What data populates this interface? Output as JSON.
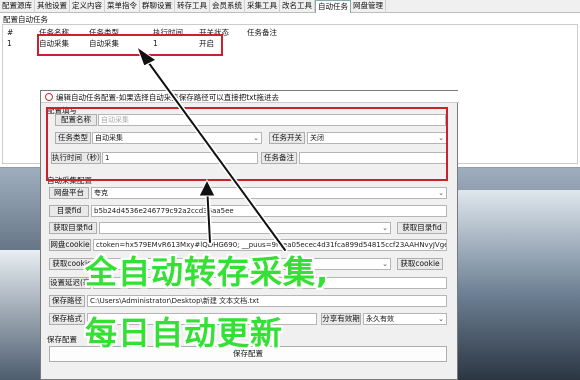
{
  "tabs": [
    "配置源库",
    "其他设置",
    "定义内容",
    "菜单指令",
    "群聊设置",
    "转存工具",
    "会员系统",
    "采集工具",
    "改名工具",
    "自动任务",
    "网盘管理"
  ],
  "active_tab_index": 9,
  "section_label": "配置自动任务",
  "grid": {
    "headers": [
      "#",
      "任务名称",
      "任务类型",
      "执行时间",
      "开关状态",
      "任务备注"
    ],
    "rows": [
      [
        "1",
        "自动采集",
        "自动采集",
        "1",
        "开启",
        ""
      ]
    ]
  },
  "dialog": {
    "title": "编辑自动任务配置-如果选择自动采集保存路径可以直接把txt拖进去",
    "group_config": "配置填写",
    "config_name_btn": "配置名称",
    "config_name_placeholder": "自动采集",
    "task_type_btn": "任务类型",
    "task_type_value": "自动采集",
    "task_switch_btn": "任务开关",
    "task_switch_value": "关闭",
    "exec_time_btn": "执行时间（秒）",
    "exec_time_value": "1",
    "task_note_btn": "任务备注",
    "task_note_value": "",
    "group_collect": "自动采集配置",
    "pan_platform_btn": "网盘平台",
    "pan_platform_value": "夸克",
    "dir_id_btn": "目录fid",
    "dir_id_value": "b5b24d4536e246779c92a2ccd36aa5ee",
    "get_dir_btn": "获取目录fid",
    "get_dir_btn2": "获取目录fid",
    "pan_cookie_btn": "网盘cookie",
    "pan_cookie_value": "ctoken=hx579EMvR613Mxy#lQDHG690; __puus=9f1ea05ecec4d31fca899d54815ccf23AAHNvyJVgeXzZ2G8dhZQQ4tgnTaYzjF/vz5Et",
    "get_cookie_btn": "获取cookie",
    "get_cookie_btn2": "获取cookie",
    "delay_btn": "设置延迟(毫",
    "save_path_btn": "保存路径",
    "save_path_value": "C:\\Users\\Administrator\\Desktop\\新建 文本文档.txt",
    "save_format_btn": "保存格式",
    "share_valid_btn": "分享有效期",
    "share_valid_value": "永久有效",
    "save_config_label": "保存配置",
    "save_config_btn": "保存配置"
  },
  "overlay": {
    "line1": "全自动转存采集,",
    "line2": "每日自动更新"
  },
  "colors": {
    "annotation_red": "#c8232c",
    "overlay_green": "#35e034"
  }
}
